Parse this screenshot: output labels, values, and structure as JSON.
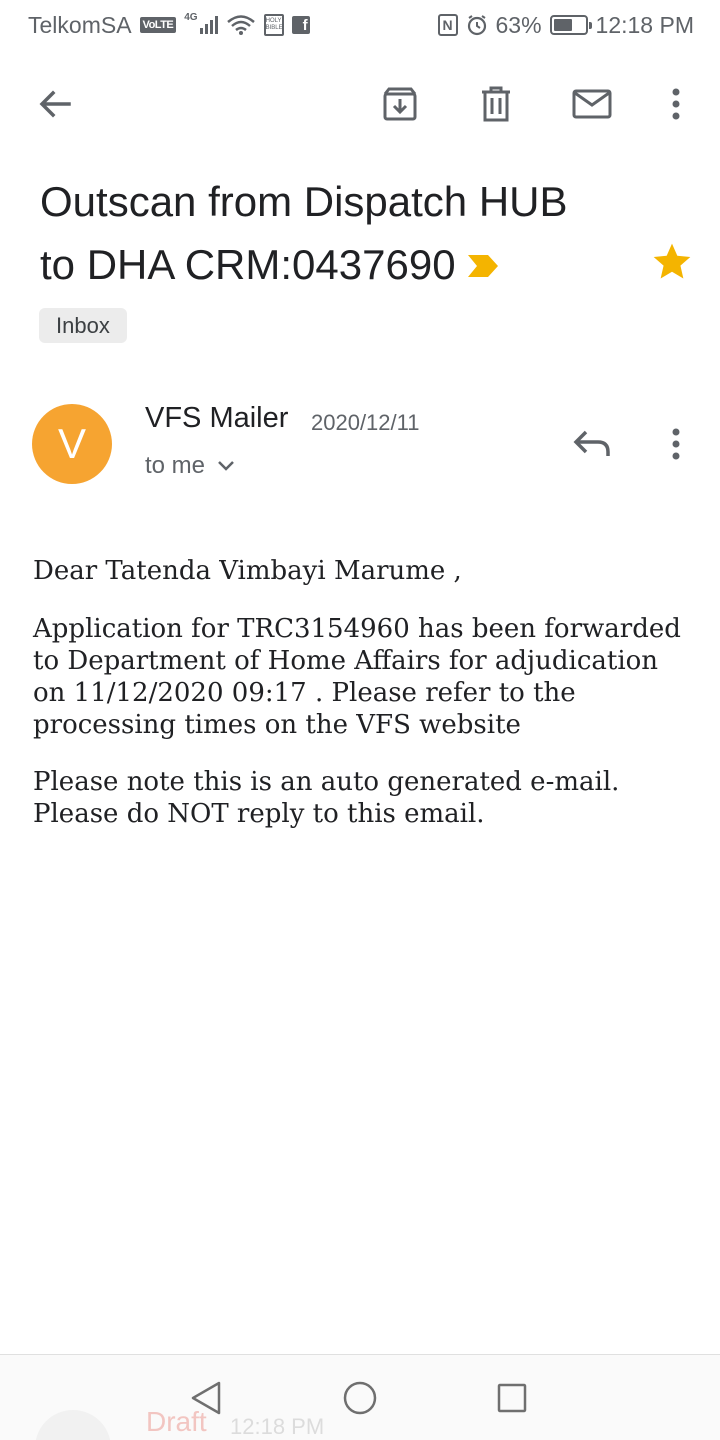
{
  "status_bar": {
    "carrier": "TelkomSA",
    "volte": "VoLTE",
    "network": "4G",
    "book_label": "HOLY BIBLE",
    "nfc": "N",
    "battery": "63%",
    "battery_level": 0.63,
    "time": "12:18 PM"
  },
  "toolbar": {
    "icons": [
      "back-arrow-icon",
      "archive-icon",
      "delete-icon",
      "mark-unread-icon",
      "more-vert-icon"
    ]
  },
  "email": {
    "subject_line1": "Outscan from Dispatch HUB",
    "subject_line2": "to DHA CRM:0437690",
    "starred": true,
    "important": true,
    "label": "Inbox",
    "sender_initial": "V",
    "sender_name": "VFS Mailer",
    "date": "2020/12/11",
    "recipients": "to me",
    "body": {
      "greeting": "Dear Tatenda Vimbayi Marume ,",
      "paragraph1_l1": "Application for  TRC3154960 has been forwarded",
      "paragraph1_l2": "to Department of Home Affairs for adjudication",
      "paragraph1_l3": "on 11/12/2020 09:17 . Please refer to the",
      "paragraph1_l4": "processing times on the VFS website",
      "paragraph2_l1": "Please note this is an auto generated e-mail.",
      "paragraph2_l2": "Please do NOT reply to this email."
    }
  },
  "draft": {
    "label": "Draft",
    "time": "12:18 PM"
  },
  "colors": {
    "avatar": "#f6a431",
    "star": "#f4b400",
    "important": "#f4b400",
    "icon": "#5f6368"
  }
}
